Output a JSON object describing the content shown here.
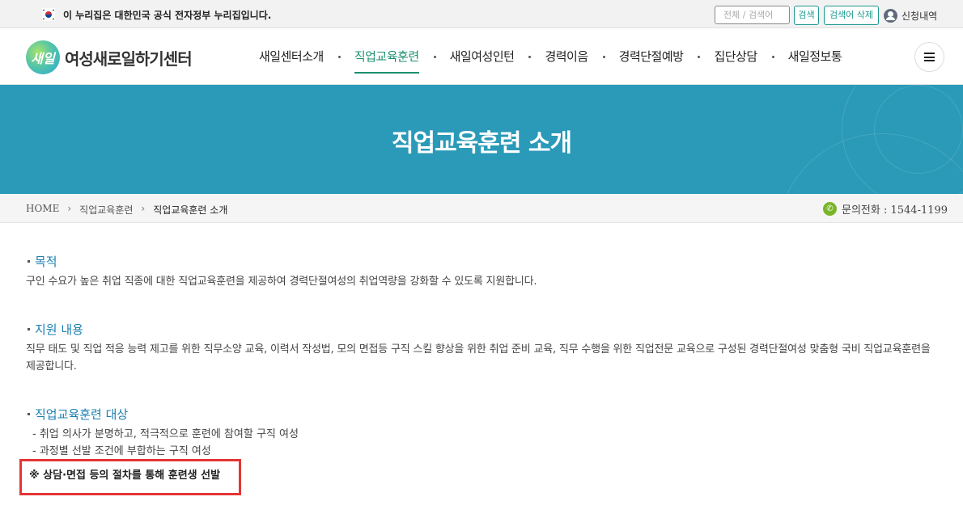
{
  "gov": {
    "notice": "이 누리집은 대한민국 공식 전자정부 누리집입니다.",
    "search_placeholder": "전체 / 검색어",
    "search_label": "검색",
    "clear_label": "검색어 삭제",
    "apply_label": "신청내역"
  },
  "header": {
    "logo_mark": "새일",
    "logo_text": "여성새로일하기센터",
    "nav": [
      {
        "label": "새일센터소개"
      },
      {
        "label": "직업교육훈련"
      },
      {
        "label": "새일여성인턴"
      },
      {
        "label": "경력이음"
      },
      {
        "label": "경력단절예방"
      },
      {
        "label": "집단상담"
      },
      {
        "label": "새일정보통"
      }
    ]
  },
  "banner": {
    "title": "직업교육훈련 소개"
  },
  "breadcrumb": {
    "home": "HOME",
    "level1": "직업교육훈련",
    "current": "직업교육훈련 소개",
    "contact": "문의전화 : 1544-1199"
  },
  "content": {
    "purpose_title": "목적",
    "purpose_text": "구인 수요가 높은 취업 직종에 대한 직업교육훈련을 제공하여 경력단절여성의 취업역량을 강화할 수 있도록 지원합니다.",
    "support_title": "지원 내용",
    "support_text": "직무 태도 및 직업 적응 능력 제고를 위한 직무소양 교육, 이력서 작성법, 모의 면접등 구직 스킬 향상을 위한 취업 준비 교육, 직무 수행을 위한 직업전문 교육으로 구성된 경력단절여성 맞춤형 국비 직업교육훈련을 제공합니다.",
    "target_title": "직업교육훈련 대상",
    "target_items": [
      "- 취업 의사가 분명하고, 적극적으로 훈련에 참여할 구직 여성",
      "- 과정별 선발 조건에 부합하는 구직 여성"
    ],
    "notice": "※ 상담·면접 등의 절차를 통해 훈련생 선발"
  },
  "colors": {
    "accent": "#1b8f6e",
    "banner": "#2a9ab8",
    "link_title": "#1a7fb0",
    "highlight_border": "#e53535"
  }
}
